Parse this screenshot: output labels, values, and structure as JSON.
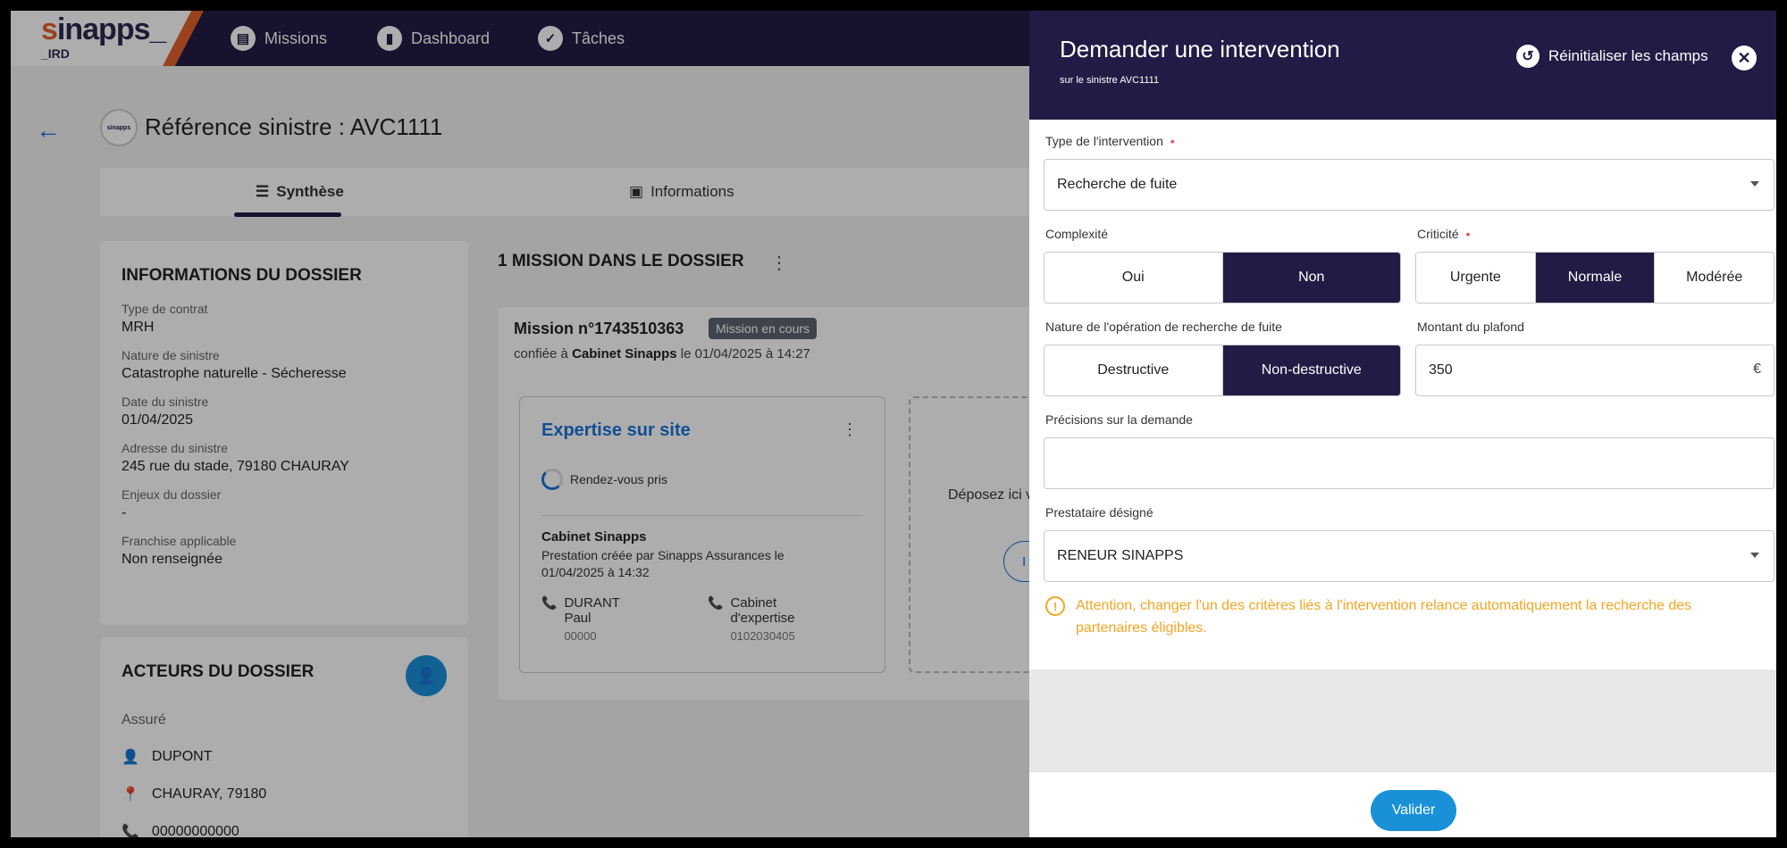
{
  "nav": {
    "logo_s": "s",
    "logo_rest": "inapps_",
    "logo_sub": "_IRD",
    "items": [
      {
        "label": "Missions",
        "icon": "folder-icon"
      },
      {
        "label": "Dashboard",
        "icon": "chart-icon"
      },
      {
        "label": "Tâches",
        "icon": "check-icon"
      }
    ]
  },
  "page": {
    "title": "Référence sinistre : AVC1111",
    "ref_logo_text": "sinapps",
    "tabs": [
      {
        "label": "Synthèse"
      },
      {
        "label": "Informations"
      }
    ]
  },
  "dossier": {
    "title": "INFORMATIONS DU DOSSIER",
    "fields": [
      {
        "label": "Type de contrat",
        "value": "MRH"
      },
      {
        "label": "Nature de sinistre",
        "value": "Catastrophe naturelle - Sécheresse"
      },
      {
        "label": "Date du sinistre",
        "value": "01/04/2025"
      },
      {
        "label": "Adresse du sinistre",
        "value": "245 rue du stade, 79180 CHAURAY"
      },
      {
        "label": "Enjeux du dossier",
        "value": "-"
      },
      {
        "label": "Franchise applicable",
        "value": "Non renseignée"
      }
    ]
  },
  "acteurs": {
    "title": "ACTEURS DU DOSSIER",
    "assure_label": "Assuré",
    "name": "DUPONT",
    "location": "CHAURAY, 79180",
    "phone": "00000000000"
  },
  "missions": {
    "heading": "1 MISSION DANS LE DOSSIER",
    "title": "Mission n°1743510363",
    "badge": "Mission en cours",
    "sub_prefix": "confiée à",
    "sub_company": "Cabinet Sinapps",
    "sub_suffix": "le 01/04/2025 à 14:27",
    "expertise_title": "Expertise sur site",
    "rdv_status": "Rendez-vous pris",
    "cabinet_name": "Cabinet Sinapps",
    "cabinet_desc": "Prestation créée par Sinapps Assurances le 01/04/2025 à 14:32",
    "contact1_line1": "DURANT",
    "contact1_line2": "Paul",
    "contact1_num": "00000",
    "contact2_line1": "Cabinet",
    "contact2_line2": "d'expertise",
    "contact2_num": "0102030405",
    "drop_text": "Déposez ici v",
    "drop_btn": "I"
  },
  "drawer": {
    "title": "Demander une intervention",
    "subtitle": "sur le sinistre AVC1111",
    "reset_label": "Réinitialiser les champs",
    "type_label": "Type de l'intervention",
    "type_value": "Recherche de fuite",
    "required_mark": "•",
    "complexite_label": "Complexité",
    "complexite_options": [
      "Oui",
      "Non"
    ],
    "complexite_selected": "Non",
    "criticite_label": "Criticité",
    "criticite_options": [
      "Urgente",
      "Normale",
      "Modérée"
    ],
    "criticite_selected": "Normale",
    "nature_label": "Nature de l'opération de recherche de fuite",
    "nature_options": [
      "Destructive",
      "Non-destructive"
    ],
    "nature_selected": "Non-destructive",
    "montant_label": "Montant du plafond",
    "montant_value": "350",
    "currency": "€",
    "precisions_label": "Précisions sur la demande",
    "precisions_value": "",
    "prestataire_label": "Prestataire désigné",
    "prestataire_value": "RENEUR SINAPPS",
    "warning": "Attention, changer l'un des critères liés à l'intervention relance automatiquement la recherche des partenaires éligibles.",
    "submit_label": "Valider"
  },
  "colors": {
    "navy": "#221b45",
    "accent_blue": "#1a90d9",
    "orange": "#e2622b",
    "warning": "#f2a623"
  }
}
